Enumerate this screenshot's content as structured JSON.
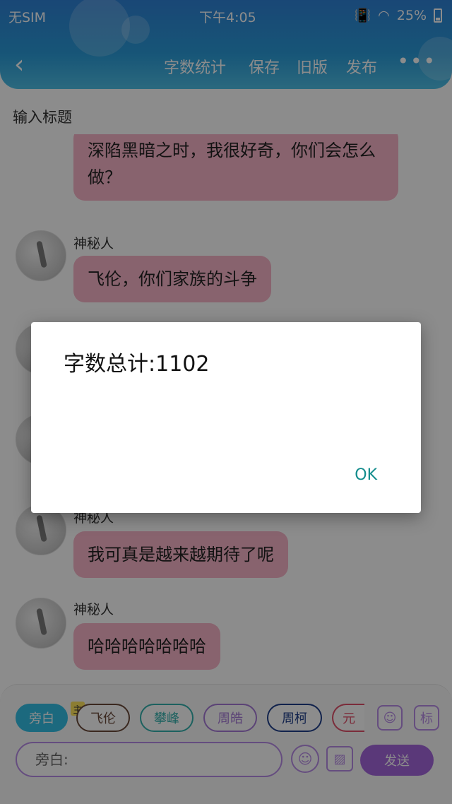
{
  "status_bar": {
    "carrier": "无SIM",
    "time": "下午4:05",
    "vibrate_icon": "vibrate-icon",
    "wifi_icon": "wifi-icon",
    "battery_percent": "25%"
  },
  "toolbar": {
    "back_icon": "chevron-left-icon",
    "word_count": "字数统计",
    "save": "保存",
    "old_version": "旧版",
    "publish": "发布",
    "more": "•••"
  },
  "title_placeholder": "输入标题",
  "messages": [
    {
      "text": "深陷黑暗之时，我很好奇，你们会怎么做？"
    },
    {
      "name": "神秘人",
      "text": "飞伦，你们家族的斗争"
    },
    {
      "name": "神秘人",
      "text": "我可真是越来越期待了呢"
    },
    {
      "name": "神秘人",
      "text": "哈哈哈哈哈哈哈"
    }
  ],
  "characters": {
    "main_badge": "主",
    "chips": [
      "旁白",
      "飞伦",
      "攀峰",
      "周皓",
      "周柯",
      "元"
    ]
  },
  "input": {
    "placeholder": "旁白:",
    "send": "发送",
    "role_icon": "person-icon",
    "tag_label": "标",
    "emoji_icon": "smile-icon",
    "image_icon": "image-icon"
  },
  "dialog": {
    "message": "字数总计:1102",
    "ok": "OK"
  }
}
